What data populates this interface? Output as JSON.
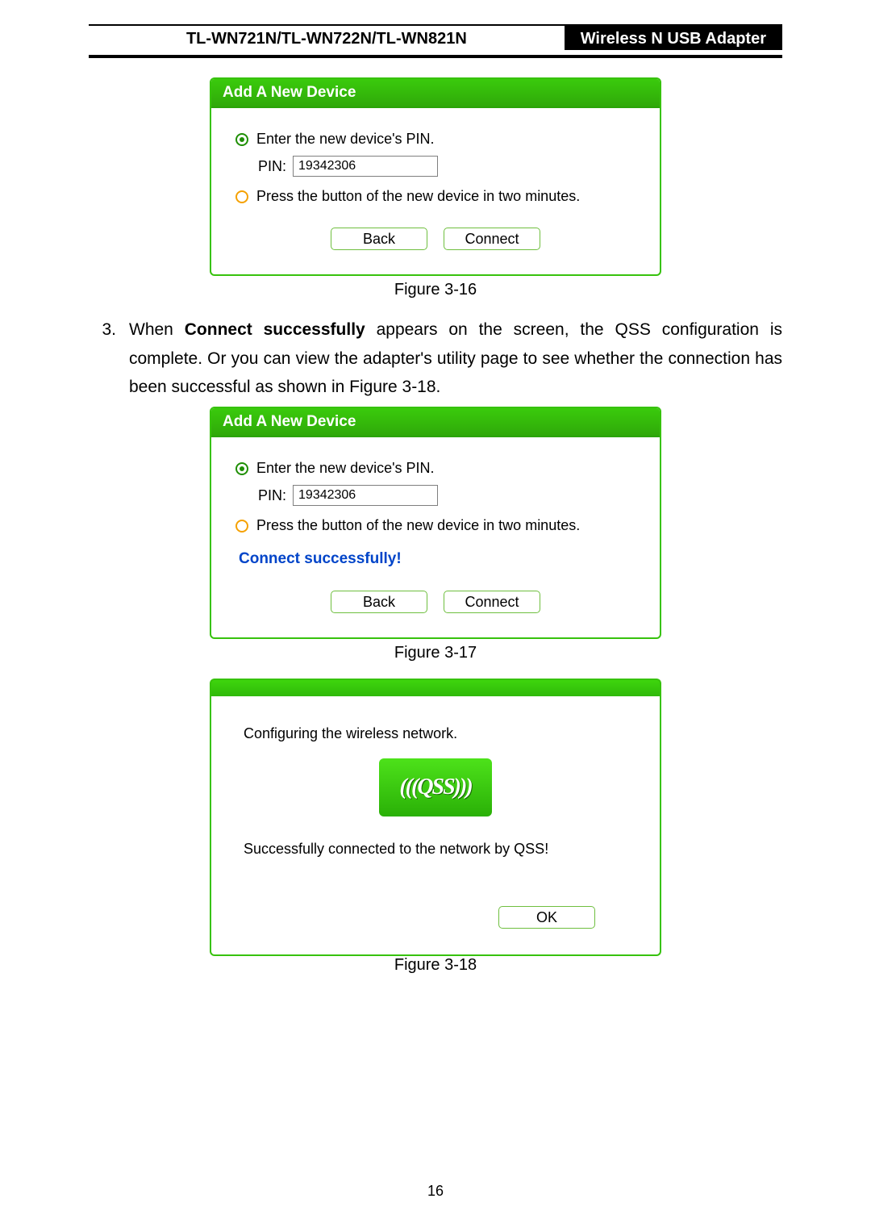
{
  "header": {
    "models": "TL-WN721N/TL-WN722N/TL-WN821N",
    "product": "Wireless N USB Adapter"
  },
  "dialog1": {
    "title": "Add A New Device",
    "option_pin": "Enter the new device's PIN.",
    "pin_label": "PIN:",
    "pin_value": "19342306",
    "option_button": "Press the button of the new device in two minutes.",
    "back": "Back",
    "connect": "Connect"
  },
  "caption1": "Figure 3-16",
  "step3": {
    "num": "3.",
    "pre": "When ",
    "bold": "Connect successfully",
    "post": " appears on the screen, the QSS configuration is complete. Or you can view the adapter's utility page to see whether the connection has been successful as shown in Figure 3-18."
  },
  "dialog2": {
    "title": "Add A New Device",
    "option_pin": "Enter the new device's PIN.",
    "pin_label": "PIN:",
    "pin_value": "19342306",
    "option_button": "Press the button of the new device in two minutes.",
    "success": "Connect successfully!",
    "back": "Back",
    "connect": "Connect"
  },
  "caption2": "Figure 3-17",
  "dialog3": {
    "configuring": "Configuring the wireless network.",
    "logo": "(((QSS)))",
    "connected": "Successfully connected to the network by QSS!",
    "ok": "OK"
  },
  "caption3": "Figure 3-18",
  "page_number": "16"
}
